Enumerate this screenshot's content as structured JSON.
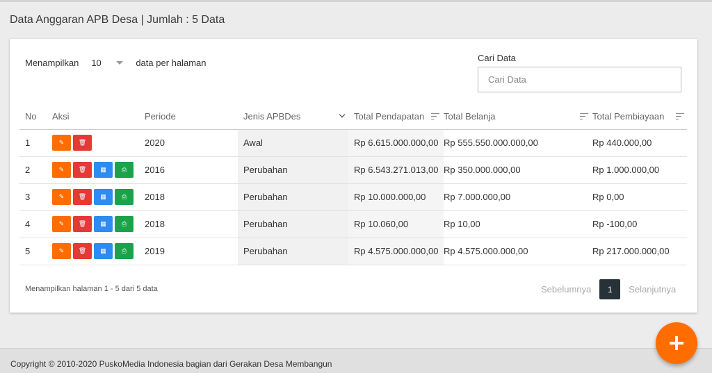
{
  "page": {
    "title": "Data Anggaran APB Desa | Jumlah : 5 Data"
  },
  "controls": {
    "show_label": "Menampilkan",
    "per_page_value": "10",
    "per_page_suffix": "data per halaman",
    "search_label": "Cari Data",
    "search_placeholder": "Cari Data"
  },
  "table": {
    "headers": {
      "no": "No",
      "aksi": "Aksi",
      "periode": "Periode",
      "jenis": "Jenis APBDes",
      "pendapatan": "Total Pendapatan",
      "belanja": "Total Belanja",
      "pembiayaan": "Total Pembiayaan"
    },
    "rows": [
      {
        "no": "1",
        "periode": "2020",
        "jenis": "Awal",
        "pendapatan": "Rp 6.615.000.000,00",
        "belanja": "Rp 555.550.000.000,00",
        "pembiayaan": "Rp 440.000,00",
        "actions": [
          "edit-icon",
          "trash-icon"
        ]
      },
      {
        "no": "2",
        "periode": "2016",
        "jenis": "Perubahan",
        "pendapatan": "Rp 6.543.271.013,00",
        "belanja": "Rp 350.000.000,00",
        "pembiayaan": "Rp 1.000.000,00",
        "actions": [
          "edit-icon",
          "trash-icon",
          "table-icon",
          "print-icon"
        ]
      },
      {
        "no": "3",
        "periode": "2018",
        "jenis": "Perubahan",
        "pendapatan": "Rp 10.000.000,00",
        "belanja": "Rp 7.000.000,00",
        "pembiayaan": "Rp 0,00",
        "actions": [
          "edit-icon",
          "trash-icon",
          "table-icon",
          "print-icon"
        ]
      },
      {
        "no": "4",
        "periode": "2018",
        "jenis": "Perubahan",
        "pendapatan": "Rp 10.060,00",
        "belanja": "Rp 10,00",
        "pembiayaan": "Rp -100,00",
        "actions": [
          "edit-icon",
          "trash-icon",
          "table-icon",
          "print-icon"
        ]
      },
      {
        "no": "5",
        "periode": "2019",
        "jenis": "Perubahan",
        "pendapatan": "Rp 4.575.000.000,00",
        "belanja": "Rp 4.575.000.000,00",
        "pembiayaan": "Rp 217.000.000,00",
        "actions": [
          "edit-icon",
          "trash-icon",
          "table-icon",
          "print-icon"
        ]
      }
    ]
  },
  "pagination": {
    "info": "Menampilkan halaman 1 - 5 dari 5 data",
    "prev": "Sebelumnya",
    "current": "1",
    "next": "Selanjutnya"
  },
  "footer": {
    "copyright": "Copyright © 2010-2020 PuskoMedia Indonesia bagian dari Gerakan Desa Membangun"
  },
  "fab": {
    "icon": "plus-icon",
    "color": "#ff6d00"
  },
  "colors": {
    "edit": "#ff6d00",
    "delete": "#e53935",
    "grid": "#2d8cf0",
    "print": "#1aa34a",
    "pager_active": "#263238"
  }
}
